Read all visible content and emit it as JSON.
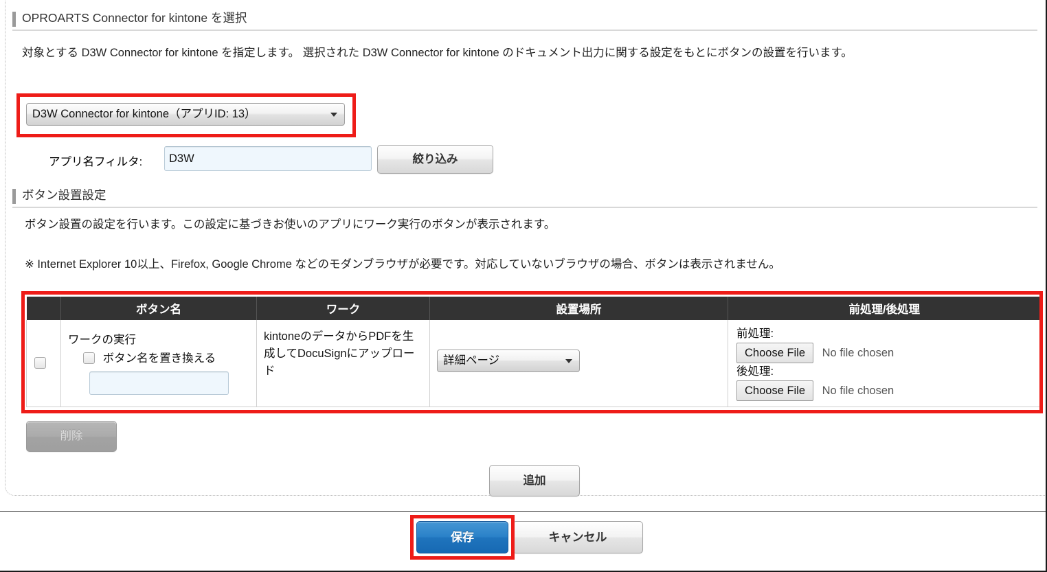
{
  "sections": {
    "connector": {
      "title": "OPROARTS Connector for kintone を選択",
      "description": "対象とする D3W Connector for kintone を指定します。 選択された D3W Connector for kintone のドキュメント出力に関する設定をもとにボタンの設置を行います。",
      "connector_select_value": "D3W Connector for kintone（アプリID: 13）",
      "filter_label": "アプリ名フィルタ:",
      "filter_value": "D3W",
      "filter_placeholder": "",
      "filter_button": "絞り込み"
    },
    "button_settings": {
      "title": "ボタン設置設定",
      "description": "ボタン設置の設定を行います。この設定に基づきお使いのアプリにワーク実行のボタンが表示されます。",
      "note": "※ Internet Explorer 10以上、Firefox, Google Chrome などのモダンブラウザが必要です。対応していないブラウザの場合、ボタンは表示されません。"
    }
  },
  "table": {
    "headers": [
      "",
      "ボタン名",
      "ワーク",
      "設置場所",
      "前処理/後処理"
    ],
    "rows": [
      {
        "selected": false,
        "button_name": "ワークの実行",
        "replace_label": "ボタン名を置き換える",
        "replace_checked": false,
        "replace_value": "",
        "replace_placeholder": "",
        "work": "kintoneのデータからPDFを生成してDocuSignにアップロード",
        "location_value": "詳細ページ",
        "pre_label": "前処理:",
        "pre_file_button": "Choose File",
        "pre_file_status": "No file chosen",
        "post_label": "後処理:",
        "post_file_button": "Choose File",
        "post_file_status": "No file chosen"
      }
    ]
  },
  "actions": {
    "delete_label": "削除",
    "add_label": "追加",
    "save_label": "保存",
    "cancel_label": "キャンセル"
  },
  "colors": {
    "annotation": "#ee1c18",
    "primary_button": "#1f74bd",
    "table_header": "#333333",
    "section_bar": "#9a9a9a"
  }
}
